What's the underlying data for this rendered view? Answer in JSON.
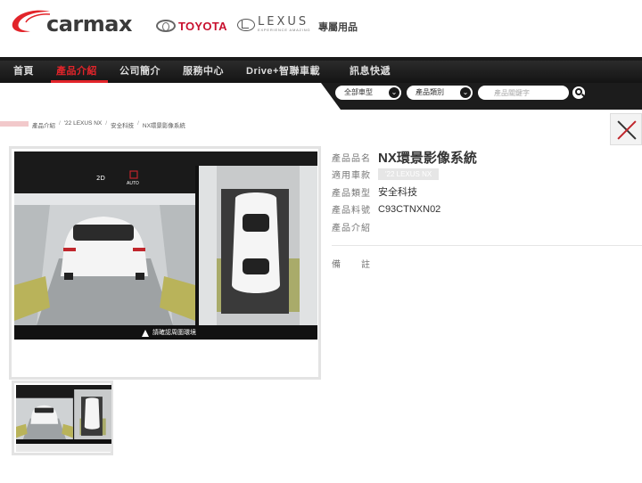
{
  "header": {
    "brand": "carmax",
    "toyota": "TOYOTA",
    "lexus": "LEXUS",
    "lexus_tagline": "EXPERIENCE AMAZING",
    "tagline": "專屬用品"
  },
  "nav": {
    "items": [
      {
        "label": "首頁"
      },
      {
        "label": "產品介紹"
      },
      {
        "label": "公司簡介"
      },
      {
        "label": "服務中心"
      },
      {
        "label": "Drive+智聯車載"
      },
      {
        "label": "訊息快遞"
      }
    ],
    "active_index": 1
  },
  "search": {
    "vehicle_select": "全部車型",
    "category_select": "產品類別",
    "keyword_placeholder": "產品關鍵字"
  },
  "breadcrumb": [
    "產品介紹",
    "'22 LEXUS NX",
    "安全科技",
    "NX環景影像系統"
  ],
  "product": {
    "name_label": "產品品名",
    "name": "NX環景影像系統",
    "model_label": "適用車款",
    "model": "'22 LEXUS NX",
    "type_label": "產品類型",
    "type": "安全科技",
    "part_label": "產品料號",
    "part_no": "C93CTNXN02",
    "intro_label": "產品介紹",
    "note_label": "備　　註"
  },
  "screen": {
    "badge_2d": "2D",
    "badge_auto": "AUTO",
    "warning": "請確認周圍環境"
  },
  "colors": {
    "accent_red": "#e2242a",
    "nav_bg": "#1c1c1c",
    "toyota_red": "#c8102e"
  }
}
